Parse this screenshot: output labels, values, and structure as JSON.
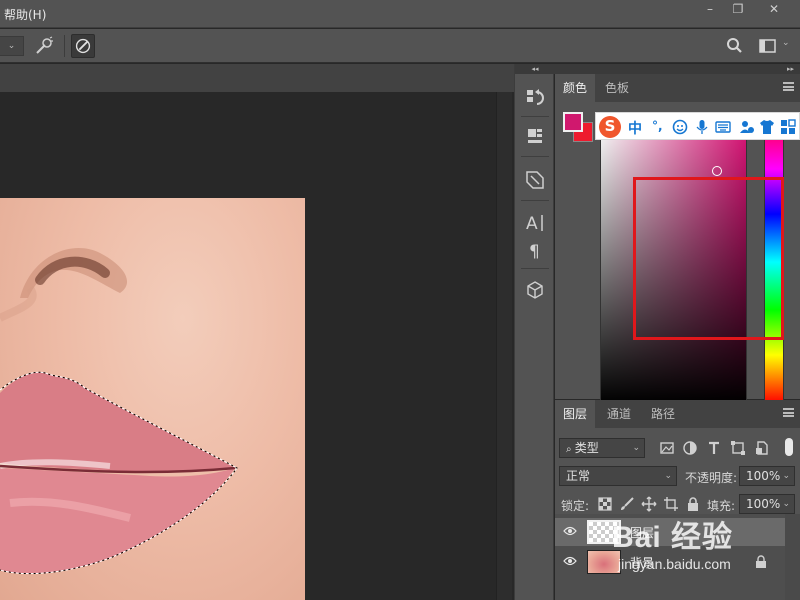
{
  "menubar": {
    "help_label": "帮助(H)",
    "win_min": "–",
    "win_max": "❐",
    "win_close": "✕"
  },
  "optionsbar": {
    "dropdown_arrow": "⌄"
  },
  "color_panel": {
    "tabs": [
      "颜色",
      "色板"
    ],
    "foreground": "#d0186e",
    "background": "#ee1b2e",
    "hue": "#e0157a"
  },
  "ime": {
    "logo": "S",
    "items": [
      "中",
      "°,"
    ]
  },
  "layers_panel": {
    "tabs": [
      "图层",
      "通道",
      "路径"
    ],
    "filter_type": "类型",
    "blend_mode": "正常",
    "opacity_label": "不透明度:",
    "opacity_value": "100%",
    "lock_label": "锁定:",
    "fill_label": "填充:",
    "fill_value": "100%",
    "layers": [
      {
        "name": "图层",
        "selected": true
      },
      {
        "name": "背景",
        "selected": false,
        "locked": true
      }
    ]
  },
  "watermark": {
    "main": "Bai 经验",
    "sub": "jingyan.baidu.com"
  },
  "icons": [
    "search-icon",
    "workspace-icon",
    "brush-tool-icon",
    "pressure-icon",
    "history-icon",
    "properties-icon",
    "adjustments-icon",
    "character-icon",
    "paragraph-icon",
    "3d-icon",
    "eye-icon",
    "lock-icon"
  ]
}
